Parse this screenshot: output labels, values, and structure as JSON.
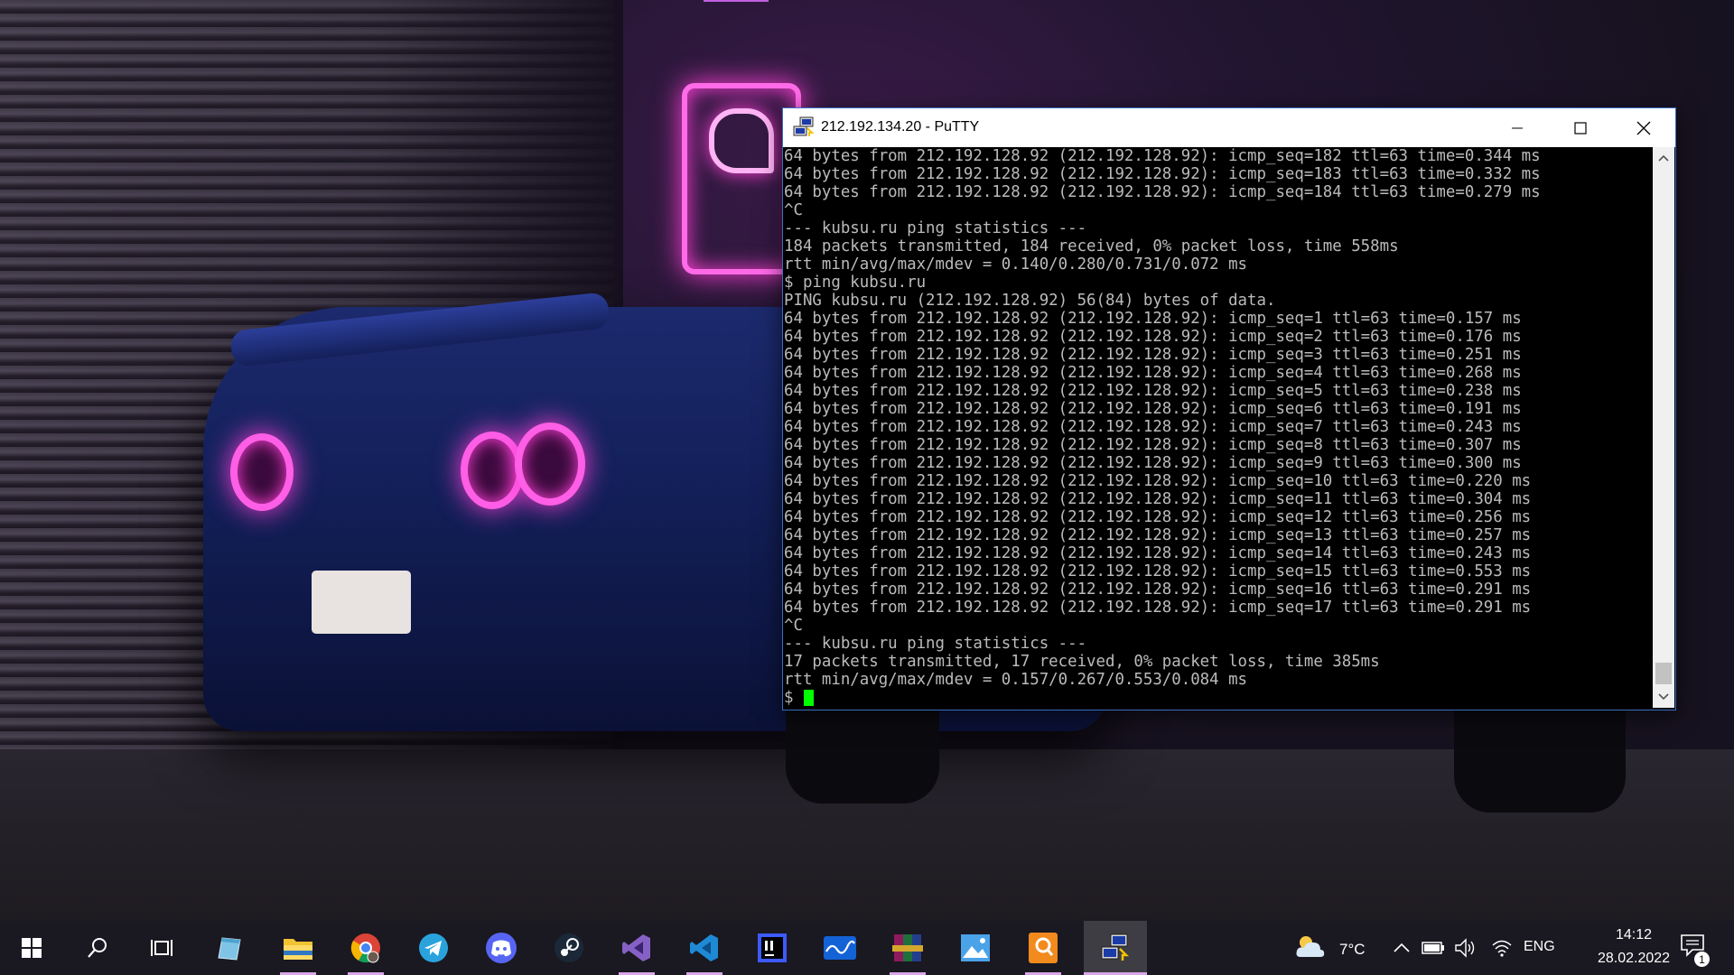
{
  "window": {
    "title": "212.192.134.20 - PuTTY"
  },
  "terminal": {
    "lines": [
      "64 bytes from 212.192.128.92 (212.192.128.92): icmp_seq=182 ttl=63 time=0.344 ms",
      "64 bytes from 212.192.128.92 (212.192.128.92): icmp_seq=183 ttl=63 time=0.332 ms",
      "64 bytes from 212.192.128.92 (212.192.128.92): icmp_seq=184 ttl=63 time=0.279 ms",
      "^C",
      "--- kubsu.ru ping statistics ---",
      "184 packets transmitted, 184 received, 0% packet loss, time 558ms",
      "rtt min/avg/max/mdev = 0.140/0.280/0.731/0.072 ms",
      "$ ping kubsu.ru",
      "PING kubsu.ru (212.192.128.92) 56(84) bytes of data.",
      "64 bytes from 212.192.128.92 (212.192.128.92): icmp_seq=1 ttl=63 time=0.157 ms",
      "64 bytes from 212.192.128.92 (212.192.128.92): icmp_seq=2 ttl=63 time=0.176 ms",
      "64 bytes from 212.192.128.92 (212.192.128.92): icmp_seq=3 ttl=63 time=0.251 ms",
      "64 bytes from 212.192.128.92 (212.192.128.92): icmp_seq=4 ttl=63 time=0.268 ms",
      "64 bytes from 212.192.128.92 (212.192.128.92): icmp_seq=5 ttl=63 time=0.238 ms",
      "64 bytes from 212.192.128.92 (212.192.128.92): icmp_seq=6 ttl=63 time=0.191 ms",
      "64 bytes from 212.192.128.92 (212.192.128.92): icmp_seq=7 ttl=63 time=0.243 ms",
      "64 bytes from 212.192.128.92 (212.192.128.92): icmp_seq=8 ttl=63 time=0.307 ms",
      "64 bytes from 212.192.128.92 (212.192.128.92): icmp_seq=9 ttl=63 time=0.300 ms",
      "64 bytes from 212.192.128.92 (212.192.128.92): icmp_seq=10 ttl=63 time=0.220 ms",
      "64 bytes from 212.192.128.92 (212.192.128.92): icmp_seq=11 ttl=63 time=0.304 ms",
      "64 bytes from 212.192.128.92 (212.192.128.92): icmp_seq=12 ttl=63 time=0.256 ms",
      "64 bytes from 212.192.128.92 (212.192.128.92): icmp_seq=13 ttl=63 time=0.257 ms",
      "64 bytes from 212.192.128.92 (212.192.128.92): icmp_seq=14 ttl=63 time=0.243 ms",
      "64 bytes from 212.192.128.92 (212.192.128.92): icmp_seq=15 ttl=63 time=0.553 ms",
      "64 bytes from 212.192.128.92 (212.192.128.92): icmp_seq=16 ttl=63 time=0.291 ms",
      "64 bytes from 212.192.128.92 (212.192.128.92): icmp_seq=17 ttl=63 time=0.291 ms",
      "^C",
      "--- kubsu.ru ping statistics ---",
      "17 packets transmitted, 17 received, 0% packet loss, time 385ms",
      "rtt min/avg/max/mdev = 0.157/0.267/0.553/0.084 ms"
    ],
    "prompt": "$ ",
    "cursor_color": "#00ff00",
    "text_color": "#bbbbbb",
    "background_color": "#000000"
  },
  "taskbar": {
    "apps": [
      {
        "name": "start-button",
        "icon": "windows-logo-icon"
      },
      {
        "name": "search-button",
        "icon": "search-icon"
      },
      {
        "name": "task-view-button",
        "icon": "task-view-icon"
      },
      {
        "name": "notepad-app",
        "icon": "notepad-icon"
      },
      {
        "name": "file-explorer-app",
        "icon": "folder-icon"
      },
      {
        "name": "chrome-app",
        "icon": "chrome-icon"
      },
      {
        "name": "telegram-app",
        "icon": "telegram-icon"
      },
      {
        "name": "discord-app",
        "icon": "discord-icon"
      },
      {
        "name": "steam-app",
        "icon": "steam-icon"
      },
      {
        "name": "visual-studio-app",
        "icon": "visual-studio-icon"
      },
      {
        "name": "vscode-app",
        "icon": "vscode-icon"
      },
      {
        "name": "intellij-app",
        "icon": "intellij-icon"
      },
      {
        "name": "photo-app",
        "icon": "waveform-icon"
      },
      {
        "name": "winrar-app",
        "icon": "winrar-icon"
      },
      {
        "name": "photos-app",
        "icon": "photos-icon"
      },
      {
        "name": "pdf-app",
        "icon": "pdf-icon"
      },
      {
        "name": "putty-app",
        "icon": "putty-icon"
      }
    ],
    "tray": {
      "weather": "7°C",
      "language": "ENG",
      "time": "14:12",
      "date": "28.02.2022",
      "notification_count": "1"
    }
  }
}
